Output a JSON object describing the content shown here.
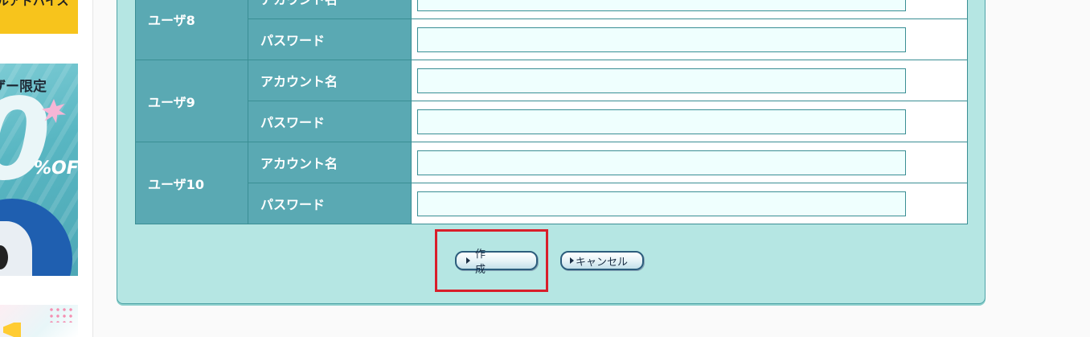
{
  "sidebar": {
    "ad_top_text": "ルアドバイス",
    "ad_banner": {
      "headline": "ザー限定",
      "big_number": "0",
      "off_text": "%OFF"
    }
  },
  "form": {
    "rows": [
      {
        "group": "ユーザ8",
        "account_label": "アカウント名",
        "password_label": "パスワード",
        "account_value": "",
        "password_value": ""
      },
      {
        "group": "ユーザ9",
        "account_label": "アカウント名",
        "password_label": "パスワード",
        "account_value": "",
        "password_value": ""
      },
      {
        "group": "ユーザ10",
        "account_label": "アカウント名",
        "password_label": "パスワード",
        "account_value": "",
        "password_value": ""
      }
    ]
  },
  "buttons": {
    "create_label": "作 成",
    "cancel_label": "キャンセル"
  },
  "colors": {
    "panel_bg": "#b5e6e3",
    "header_cell_bg": "#5aa9b3",
    "input_bg": "#effffe",
    "highlight_border": "#d81e2a"
  }
}
